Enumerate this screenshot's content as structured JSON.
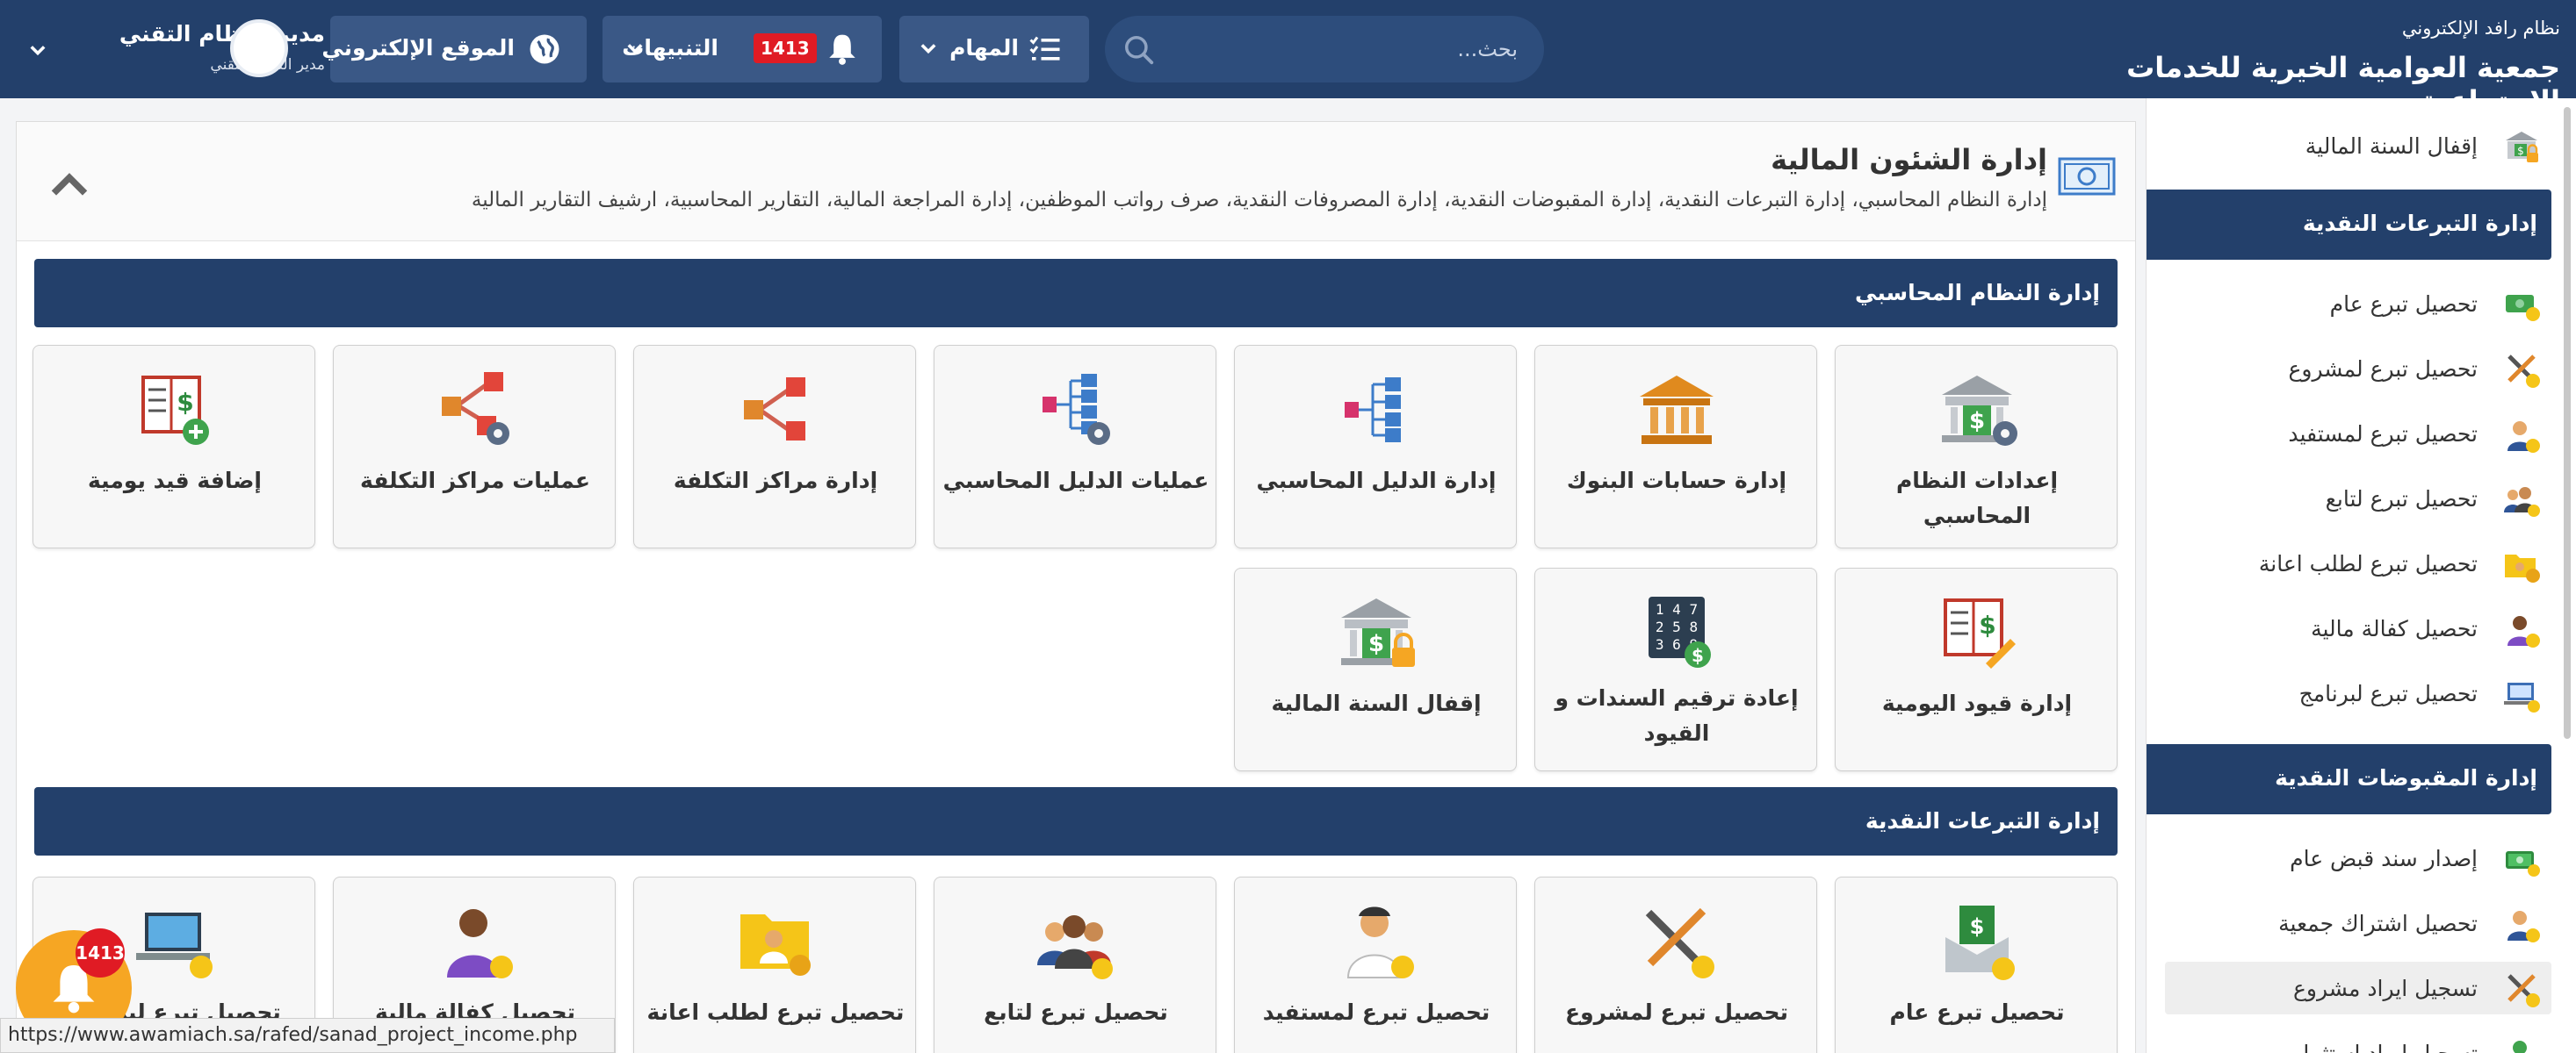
{
  "header": {
    "system_name": "نظام رافد الإلكتروني",
    "org_name": "جمعية العوامية الخيرية للخدمات الإجتماعية",
    "search_placeholder": "بحث...",
    "tasks_label": "المهام",
    "alerts_label": "التنبيهات",
    "alerts_count": "1413",
    "website_label": "الموقع الإلكتروني",
    "user_name": "مدير النظام التقني",
    "user_role": "مدير النظام التقني"
  },
  "sidebar": {
    "items_top": [
      {
        "label": "إقفال السنة المالية",
        "icon": "lock-bank-icon"
      }
    ],
    "sections": [
      {
        "title": "إدارة التبرعات النقدية",
        "items": [
          {
            "label": "تحصيل تبرع عام",
            "icon": "money-icon"
          },
          {
            "label": "تحصيل تبرع لمشروع",
            "icon": "tools-icon"
          },
          {
            "label": "تحصيل تبرع لمستفيد",
            "icon": "person-icon"
          },
          {
            "label": "تحصيل تبرع لتابع",
            "icon": "group-icon"
          },
          {
            "label": "تحصيل تبرع لطلب اعانة",
            "icon": "folder-icon"
          },
          {
            "label": "تحصيل كفالة مالية",
            "icon": "person-coin-icon"
          },
          {
            "label": "تحصيل تبرع لبرنامج",
            "icon": "laptop-icon"
          }
        ]
      },
      {
        "title": "إدارة المقبوضات النقدية",
        "items": [
          {
            "label": "إصدار سند قبض عام",
            "icon": "money-stack-icon"
          },
          {
            "label": "تحصيل اشتراك جمعية",
            "icon": "person-icon"
          },
          {
            "label": "تسجيل ايراد مشروع",
            "icon": "tools-icon"
          },
          {
            "label": "تسجيل ايراد استثمار",
            "icon": "person-icon"
          }
        ]
      }
    ]
  },
  "panel": {
    "title": "إدارة الشئون المالية",
    "subtitle": "إدارة النظام المحاسبي، إدارة التبرعات النقدية، إدارة المقبوضات النقدية، إدارة المصروفات النقدية، صرف رواتب الموظفين، إدارة المراجعة المالية، التقارير المحاسبية، ارشيف التقارير المالية",
    "sections": [
      {
        "title": "إدارة النظام المحاسبي",
        "tiles": [
          {
            "label": "إعدادات النظام المحاسبي",
            "icon": "bank-gear-icon"
          },
          {
            "label": "إدارة حسابات البنوك",
            "icon": "bank-icon"
          },
          {
            "label": "إدارة الدليل المحاسبي",
            "icon": "tree-icon"
          },
          {
            "label": "عمليات الدليل المحاسبي",
            "icon": "tree-gear-icon"
          },
          {
            "label": "إدارة مراكز التكلفة",
            "icon": "share-icon"
          },
          {
            "label": "عمليات مراكز التكلفة",
            "icon": "share-gear-icon"
          },
          {
            "label": "إضافة قيد يومية",
            "icon": "ledger-add-icon"
          },
          {
            "label": "إدارة قيود اليومية",
            "icon": "ledger-edit-icon"
          },
          {
            "label": "إعادة ترقيم السندات و القيود",
            "icon": "numbers-icon"
          },
          {
            "label": "إقفال السنة المالية",
            "icon": "bank-lock-icon"
          }
        ]
      },
      {
        "title": "إدارة التبرعات النقدية",
        "tiles": [
          {
            "label": "تحصيل تبرع عام",
            "icon": "money-hand-icon"
          },
          {
            "label": "تحصيل تبرع لمشروع",
            "icon": "tools-icon"
          },
          {
            "label": "تحصيل تبرع لمستفيد",
            "icon": "person-icon"
          },
          {
            "label": "تحصيل تبرع لتابع",
            "icon": "group-icon"
          },
          {
            "label": "تحصيل تبرع لطلب اعانة",
            "icon": "folder-icon"
          },
          {
            "label": "تحصيل كفالة مالية",
            "icon": "person-coin-icon"
          },
          {
            "label": "تحصيل تبرع لبرنامج",
            "icon": "laptop-icon"
          }
        ]
      }
    ]
  },
  "floating": {
    "count": "1413"
  },
  "status_url": "https://www.awamiach.sa/rafed/sanad_project_income.php",
  "colors": {
    "navy": "#23406b",
    "accent_gold": "#f6a623",
    "alert_red": "#e01b24"
  }
}
